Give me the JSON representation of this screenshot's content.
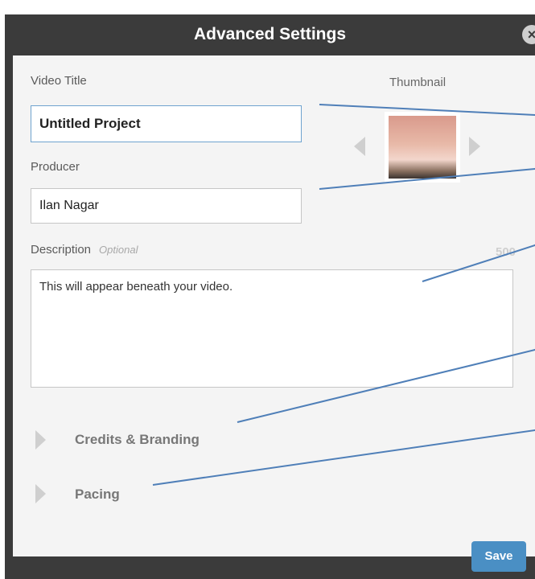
{
  "dialog": {
    "title": "Advanced Settings",
    "close_icon": "close-icon",
    "save_label": "Save"
  },
  "form": {
    "video_title_label": "Video Title",
    "video_title_value": "Untitled Project",
    "producer_label": "Producer",
    "producer_value": "Ilan Nagar",
    "description_label": "Description",
    "description_optional": "Optional",
    "description_counter": "500",
    "description_placeholder": "This will appear beneath your video."
  },
  "thumbnail": {
    "label": "Thumbnail",
    "prev_icon": "chevron-left-icon",
    "next_icon": "chevron-right-icon"
  },
  "sections": [
    {
      "label": "Credits & Branding",
      "icon": "expand-triangle-icon"
    },
    {
      "label": "Pacing",
      "icon": "expand-triangle-icon"
    }
  ],
  "colors": {
    "dialog_bg": "#3b3b3b",
    "panel_bg": "#f4f4f4",
    "accent": "#4a8fc4",
    "annotation_arrow": "#4f7fb8"
  }
}
